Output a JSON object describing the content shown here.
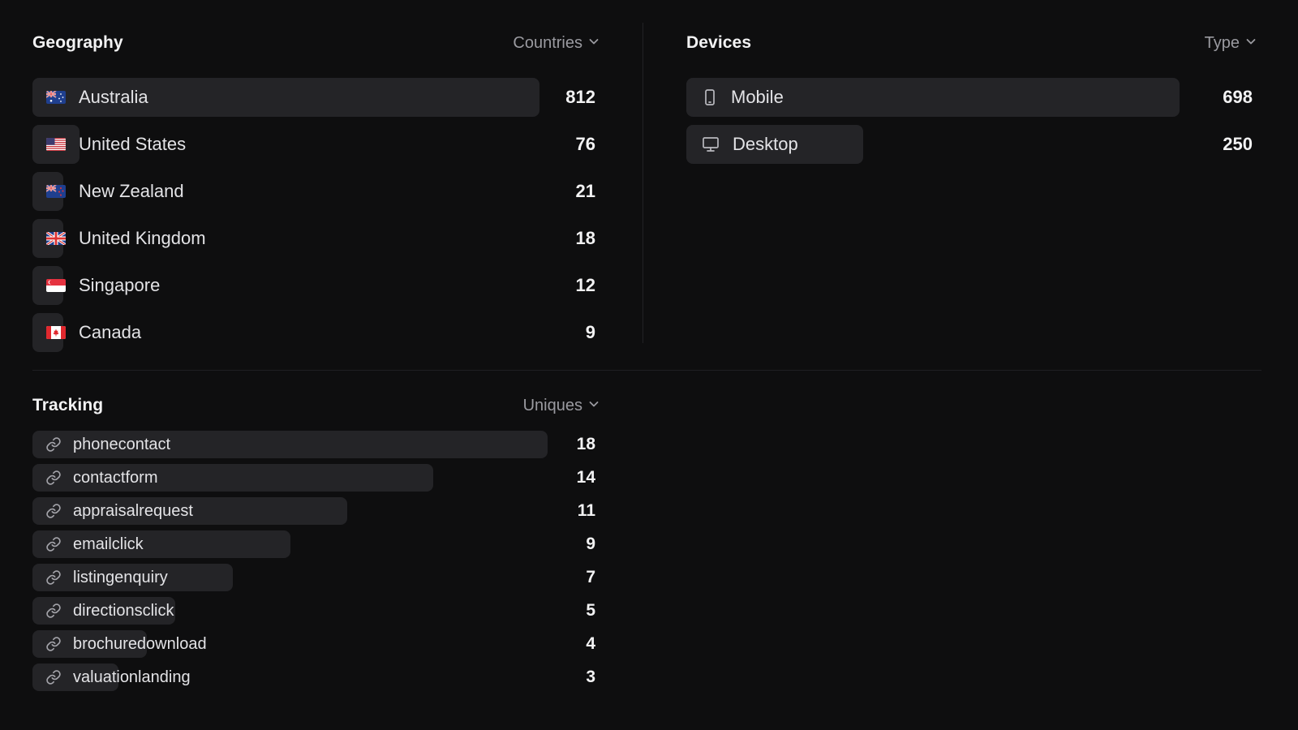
{
  "geography": {
    "title": "Geography",
    "dropdown_label": "Countries",
    "max_value": 812,
    "rows": [
      {
        "label": "Australia",
        "value": "812",
        "amount": 812,
        "flag": "australia-flag-icon"
      },
      {
        "label": "United States",
        "value": "76",
        "amount": 76,
        "flag": "united-states-flag-icon"
      },
      {
        "label": "New Zealand",
        "value": "21",
        "amount": 21,
        "flag": "new-zealand-flag-icon"
      },
      {
        "label": "United Kingdom",
        "value": "18",
        "amount": 18,
        "flag": "united-kingdom-flag-icon"
      },
      {
        "label": "Singapore",
        "value": "12",
        "amount": 12,
        "flag": "singapore-flag-icon"
      },
      {
        "label": "Canada",
        "value": "9",
        "amount": 9,
        "flag": "canada-flag-icon"
      }
    ]
  },
  "devices": {
    "title": "Devices",
    "dropdown_label": "Type",
    "max_value": 698,
    "rows": [
      {
        "label": "Mobile",
        "value": "698",
        "amount": 698,
        "icon": "mobile-phone-icon"
      },
      {
        "label": "Desktop",
        "value": "250",
        "amount": 250,
        "icon": "desktop-monitor-icon"
      }
    ]
  },
  "tracking": {
    "title": "Tracking",
    "dropdown_label": "Uniques",
    "max_value": 18,
    "rows": [
      {
        "label": "phonecontact",
        "value": "18",
        "amount": 18,
        "icon": "link-icon"
      },
      {
        "label": "contactform",
        "value": "14",
        "amount": 14,
        "icon": "link-icon"
      },
      {
        "label": "appraisalrequest",
        "value": "11",
        "amount": 11,
        "icon": "link-icon"
      },
      {
        "label": "emailclick",
        "value": "9",
        "amount": 9,
        "icon": "link-icon"
      },
      {
        "label": "listingenquiry",
        "value": "7",
        "amount": 7,
        "icon": "link-icon"
      },
      {
        "label": "directionsclick",
        "value": "5",
        "amount": 5,
        "icon": "link-icon"
      },
      {
        "label": "brochuredownload",
        "value": "4",
        "amount": 4,
        "icon": "link-icon"
      },
      {
        "label": "valuationlanding",
        "value": "3",
        "amount": 3,
        "icon": "link-icon"
      }
    ]
  },
  "colors": {
    "background": "#0e0e0f",
    "bar": "#242427",
    "text": "#e3e3e6",
    "muted": "#9a9aa0"
  }
}
